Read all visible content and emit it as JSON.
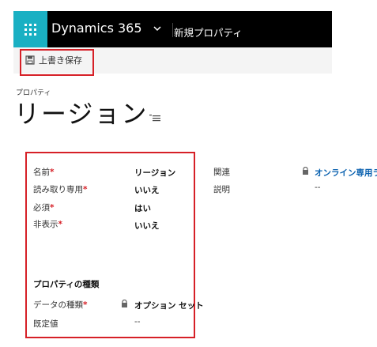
{
  "header": {
    "app_name": "Dynamics 365",
    "breadcrumb": "新規プロパティ"
  },
  "toolbar": {
    "save_label": "上書き保存"
  },
  "form": {
    "entity_label": "プロパティ",
    "title": "リージョン",
    "fields_left": [
      {
        "label": "名前",
        "required": "*",
        "value": "リージョン"
      },
      {
        "label": "読み取り専用",
        "required": "*",
        "value": "いいえ"
      },
      {
        "label": "必須",
        "required": "*",
        "value": "はい"
      },
      {
        "label": "非表示",
        "required": "*",
        "value": "いいえ"
      }
    ],
    "section_title": "プロパティの種類",
    "data_type": {
      "label": "データの種類",
      "required": "*",
      "value": "オプション セット"
    },
    "default_value": {
      "label": "既定値",
      "value": "--"
    },
    "fields_right": [
      {
        "label": "関連",
        "value": "オンライン専用ラ"
      },
      {
        "label": "説明",
        "value": "--"
      }
    ]
  },
  "colors": {
    "topbar": "#000000",
    "waffle": "#1ab0c3",
    "highlight": "#d62027",
    "link": "#0b62b0"
  }
}
